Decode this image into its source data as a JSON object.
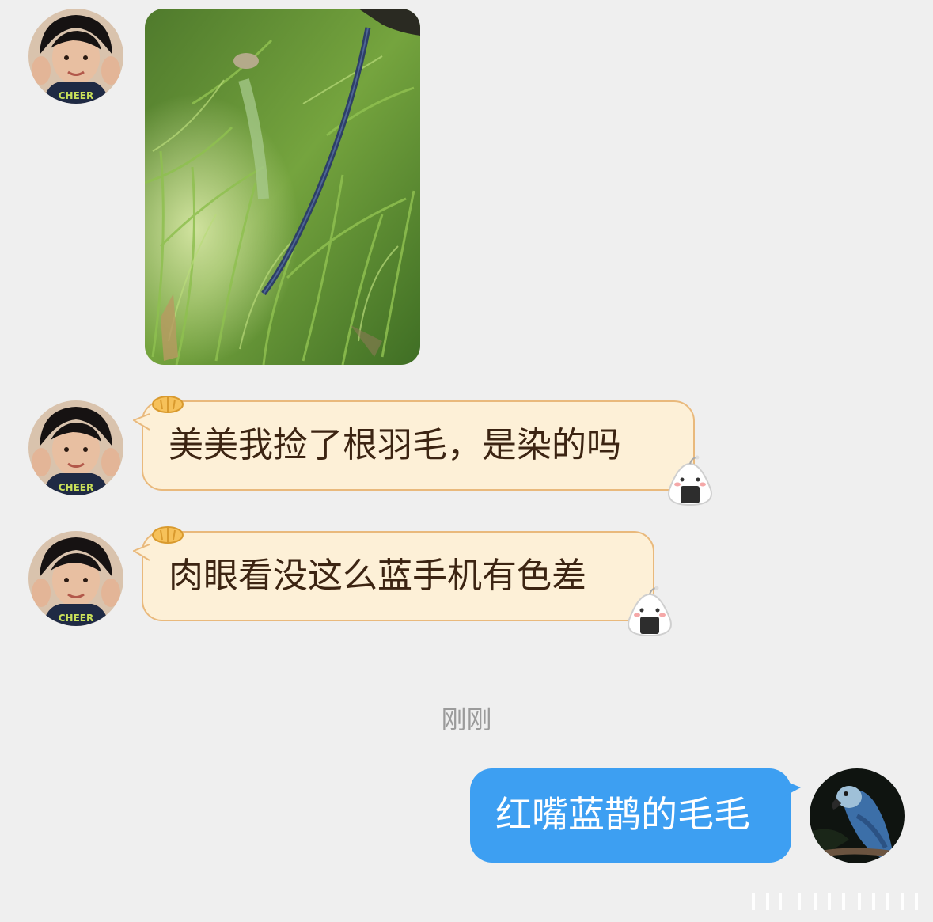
{
  "messages": {
    "msg1": {
      "text": "美美我捡了根羽毛，是染的吗"
    },
    "msg2": {
      "text": "肉眼看没这么蓝手机有色差"
    },
    "timestamp": "刚刚",
    "reply": {
      "text": "红嘴蓝鹊的毛毛"
    }
  },
  "colors": {
    "background": "#efefef",
    "incoming_bubble": "#fdf0d7",
    "incoming_border": "#e9b97c",
    "outgoing_bubble": "#3d9ff2"
  }
}
